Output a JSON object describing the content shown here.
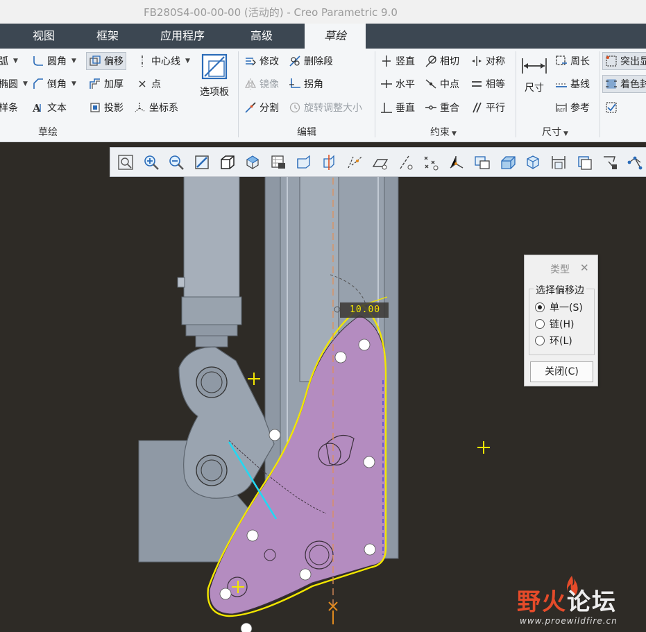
{
  "window": {
    "title": "FB280S4-00-00-00 (活动的) - Creo Parametric 9.0"
  },
  "tabs": [
    {
      "label": "视图"
    },
    {
      "label": "框架"
    },
    {
      "label": "应用程序"
    },
    {
      "label": "高级"
    },
    {
      "label": "草绘"
    }
  ],
  "ribbon": {
    "sketch": {
      "arc_partial": "弧",
      "ellipse_partial": "椭圆",
      "spline_partial": "样条",
      "fillet": "圆角",
      "chamfer": "倒角",
      "text": "文本",
      "offset": "偏移",
      "thicken": "加厚",
      "project": "投影",
      "centerline": "中心线",
      "point": "点",
      "coordsys": "坐标系",
      "palette": "选项板",
      "group": "草绘"
    },
    "edit": {
      "modify": "修改",
      "mirror": "镜像",
      "divide": "分割",
      "delete_segment": "删除段",
      "corner": "拐角",
      "rotate_resize": "旋转调整大小",
      "group": "编辑"
    },
    "constrain": {
      "vertical": "竖直",
      "horizontal": "水平",
      "perpendicular": "垂直",
      "tangent": "相切",
      "midpoint": "中点",
      "coincident": "重合",
      "symmetric": "对称",
      "equal": "相等",
      "parallel": "平行",
      "group": "约束"
    },
    "dimension": {
      "dimension": "尺寸",
      "perimeter": "周长",
      "baseline": "基线",
      "reference": "参考",
      "group": "尺寸"
    },
    "inspect": {
      "highlight_partial": "突出显",
      "shade_partial": "着色封"
    }
  },
  "viewport": {
    "offset_value": "10.00"
  },
  "dialog": {
    "title": "类型",
    "section": "选择偏移边",
    "options": [
      {
        "label": "单一(S)",
        "selected": true
      },
      {
        "label": "链(H)",
        "selected": false
      },
      {
        "label": "环(L)",
        "selected": false
      }
    ],
    "close": "关闭(C)"
  },
  "watermark": {
    "main_a": "野",
    "main_b": "火",
    "main_c": "论坛",
    "sub": "www.proewildfire.cn"
  },
  "colors": {
    "tab_bar": "#3c4752",
    "ribbon_bg": "#f4f6f8",
    "viewport_bg": "#2e2b26",
    "sketch_line": "#f2e600",
    "part_fill": "#b48cc0",
    "gray_part": "#8f99a5"
  }
}
